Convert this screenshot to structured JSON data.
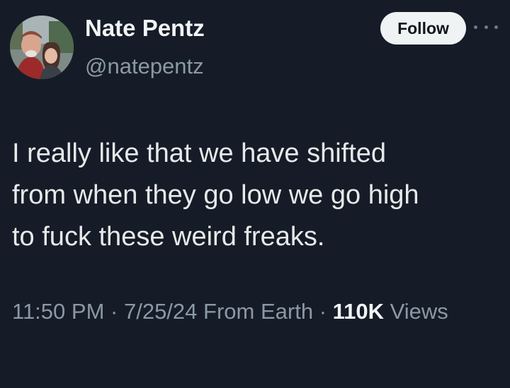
{
  "user": {
    "display_name": "Nate Pentz",
    "handle": "@natepentz"
  },
  "actions": {
    "follow_label": "Follow",
    "more_icon": "more-horizontal-icon"
  },
  "tweet": {
    "text": "I really like that we have shifted\nfrom when they go low we go high\nto fuck these weird freaks."
  },
  "meta": {
    "time": "11:50 PM",
    "separator": "·",
    "date": "7/25/24",
    "source": "From Earth",
    "views_count": "110K",
    "views_label": "Views"
  },
  "colors": {
    "background": "#151c27",
    "text": "#e7e9ea",
    "muted": "#8b98a5",
    "button_bg": "#eff3f4",
    "button_text": "#0f1419"
  }
}
